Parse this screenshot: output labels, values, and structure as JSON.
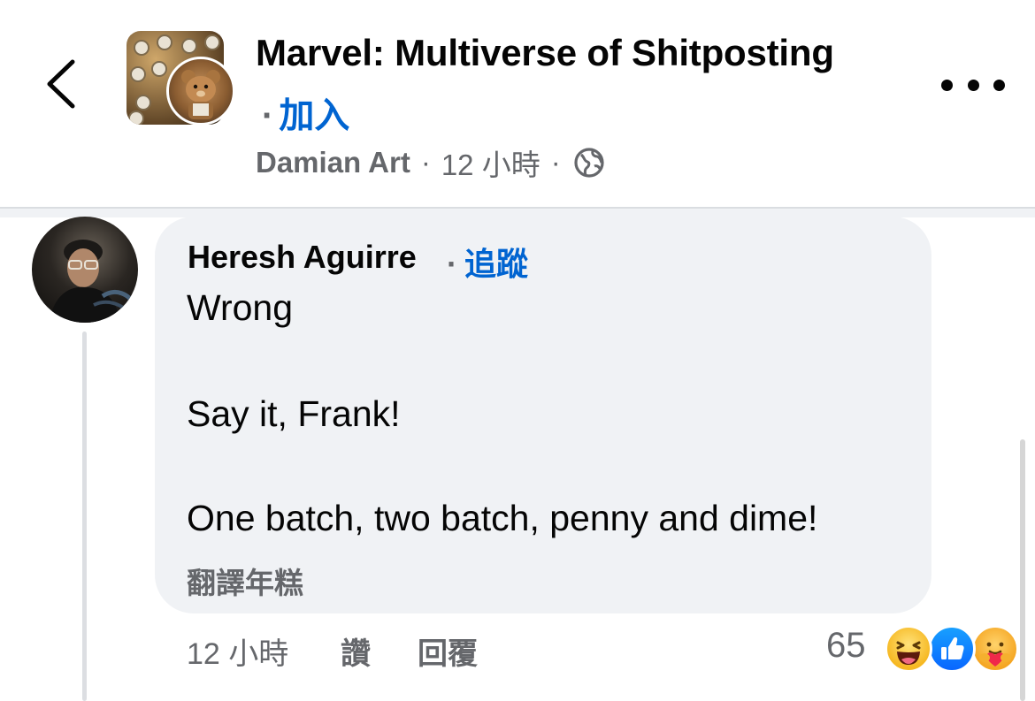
{
  "header": {
    "group_name": "Marvel: Multiverse of Shitposting",
    "join_separator": "·",
    "join_label": "加入",
    "author": "Damian Art",
    "time_separator": "·",
    "time": "12 小時",
    "privacy_separator": "·",
    "privacy_icon": "globe-icon"
  },
  "comment": {
    "author": "Heresh Aguirre",
    "follow_separator": "·",
    "follow_label": "追蹤",
    "lines": [
      "Wrong",
      "Say it, Frank!",
      "One batch, two batch, penny and dime!"
    ],
    "translate_label": "翻譯年糕",
    "actions": {
      "time": "12 小時",
      "like_label": "讚",
      "reply_label": "回覆"
    },
    "reaction_count": "65",
    "reactions": [
      "haha",
      "like",
      "care"
    ]
  },
  "colors": {
    "link_blue": "#0064d1",
    "secondary_text": "#65676b",
    "bubble_bg": "#f0f2f5"
  }
}
